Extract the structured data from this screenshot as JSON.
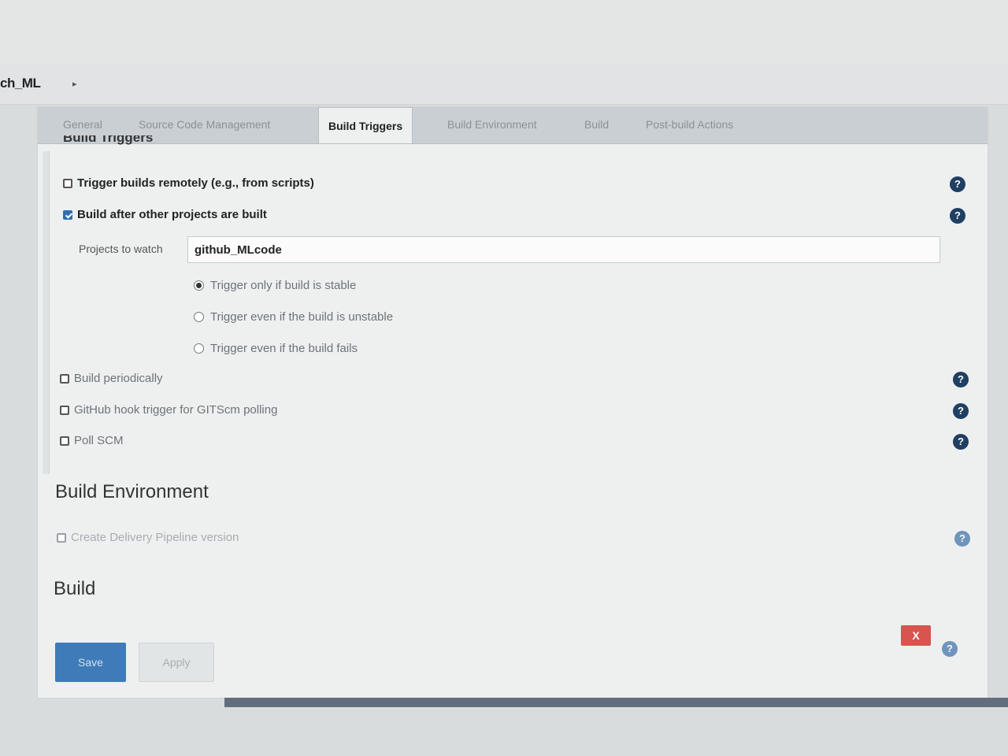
{
  "breadcrumb": {
    "job": "ch_ML"
  },
  "tabs": [
    {
      "label": "General",
      "active": false
    },
    {
      "label": "Source Code Management",
      "active": false
    },
    {
      "label": "Build Triggers",
      "active": true
    },
    {
      "label": "Build Environment",
      "active": false
    },
    {
      "label": "Build",
      "active": false
    },
    {
      "label": "Post-build Actions",
      "active": false
    }
  ],
  "section_header": "Build Triggers",
  "triggers": {
    "remote": {
      "label": "Trigger builds remotely (e.g., from scripts)",
      "checked": false
    },
    "after_other": {
      "label": "Build after other projects are built",
      "checked": true
    },
    "projects_label": "Projects to watch",
    "projects_value": "github_MLcode",
    "radios": [
      {
        "label": "Trigger only if build is stable",
        "checked": true
      },
      {
        "label": "Trigger even if the build is unstable",
        "checked": false
      },
      {
        "label": "Trigger even if the build fails",
        "checked": false
      }
    ],
    "periodically": {
      "label": "Build periodically",
      "checked": false
    },
    "github_hook": {
      "label": "GitHub hook trigger for GITScm polling",
      "checked": false
    },
    "poll_scm": {
      "label": "Poll SCM",
      "checked": false
    }
  },
  "build_environment": {
    "title": "Build Environment",
    "pipeline": {
      "label": "Create Delivery Pipeline version",
      "checked": false
    }
  },
  "build": {
    "title": "Build"
  },
  "buttons": {
    "save": "Save",
    "apply": "Apply",
    "delete": "X"
  },
  "help_glyph": "?",
  "colors": {
    "primary": "#3f7bb8",
    "danger": "#d9534f",
    "help": "#1f3f63"
  }
}
